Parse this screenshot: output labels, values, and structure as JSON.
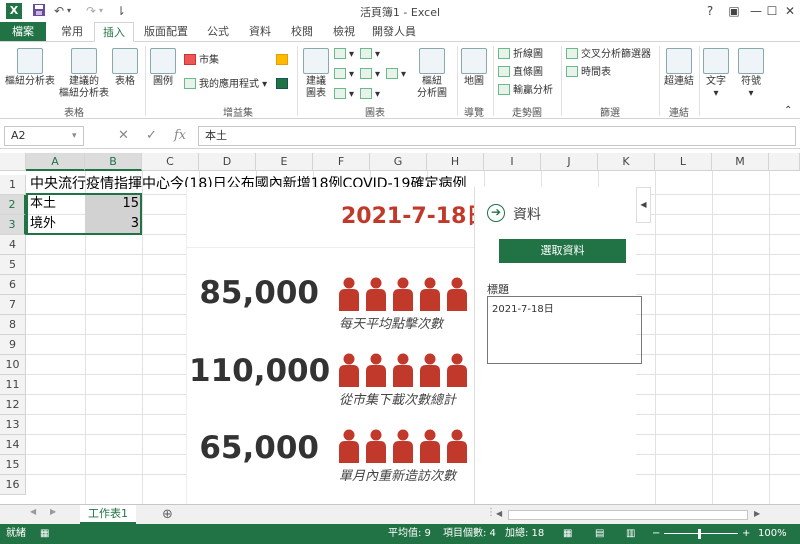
{
  "titlebar": {
    "title": "活頁簿1 - Excel",
    "app_icon_letter": "X",
    "undo": "↶",
    "redo": "↷",
    "customize": "⇂",
    "help": "?",
    "ribbon_display": "▣",
    "minimize": "—",
    "maximize": "☐",
    "close": "✕"
  },
  "tabs": [
    "檔案",
    "常用",
    "插入",
    "版面配置",
    "公式",
    "資料",
    "校閱",
    "檢視",
    "開發人員"
  ],
  "ribbon": {
    "pivot_table": "樞紐分析表",
    "recommended_pivot_1": "建議的",
    "recommended_pivot_2": "樞紐分析表",
    "table": "表格",
    "group_tables": "表格",
    "illustrations": "圖例",
    "store": "市集",
    "my_apps": "我的應用程式",
    "group_addins": "增益集",
    "recommended_charts_1": "建議",
    "recommended_charts_2": "圖表",
    "pivot_chart_1": "樞紐",
    "pivot_chart_2": "分析圖",
    "group_charts": "圖表",
    "map": "地圖",
    "group_tours": "導覽",
    "line": "折線圖",
    "column": "直條圖",
    "win_loss": "輸贏分析",
    "group_sparklines": "走勢圖",
    "slicer": "交叉分析篩選器",
    "timeline": "時間表",
    "group_filters": "篩選",
    "hyperlink": "超連結",
    "group_links": "連結",
    "text": "文字",
    "symbols": "符號"
  },
  "formula_bar": {
    "name_box": "A2",
    "fx": "fx",
    "cancel": "✕",
    "enter": "✓",
    "content": "本土"
  },
  "grid": {
    "columns": [
      "A",
      "B",
      "C",
      "D",
      "E",
      "F",
      "G",
      "H",
      "I",
      "J",
      "K",
      "L",
      "M"
    ],
    "rows": [
      "1",
      "2",
      "3",
      "4",
      "5",
      "6",
      "7",
      "8",
      "9",
      "10",
      "11",
      "12",
      "13",
      "14",
      "15",
      "16"
    ],
    "a1": "中央流行疫情指揮中心今(18)日公布國內新增18例COVID-19確定病例",
    "a2": "本土",
    "b2": "15",
    "a3": "境外",
    "b3": "3"
  },
  "infographic": {
    "title": "2021-7-18日",
    "stats": [
      {
        "number": "85,000",
        "caption": "每天平均點擊次數"
      },
      {
        "number": "110,000",
        "caption": "從市集下載次數總計"
      },
      {
        "number": "65,000",
        "caption": "單月內重新造訪次數"
      }
    ],
    "people_color": "#c0392b"
  },
  "pane": {
    "heading": "資料",
    "select_data": "選取資料",
    "title_label": "標題",
    "title_value": "2021-7-18日"
  },
  "sheets": {
    "tab": "工作表1",
    "add": "⊕"
  },
  "status": {
    "ready": "就緒",
    "average": "平均值: 9",
    "count": "項目個數: 4",
    "sum": "加總: 18",
    "zoom": "100%"
  },
  "colors": {
    "accent": "#217346",
    "title_red": "#c0392b"
  }
}
